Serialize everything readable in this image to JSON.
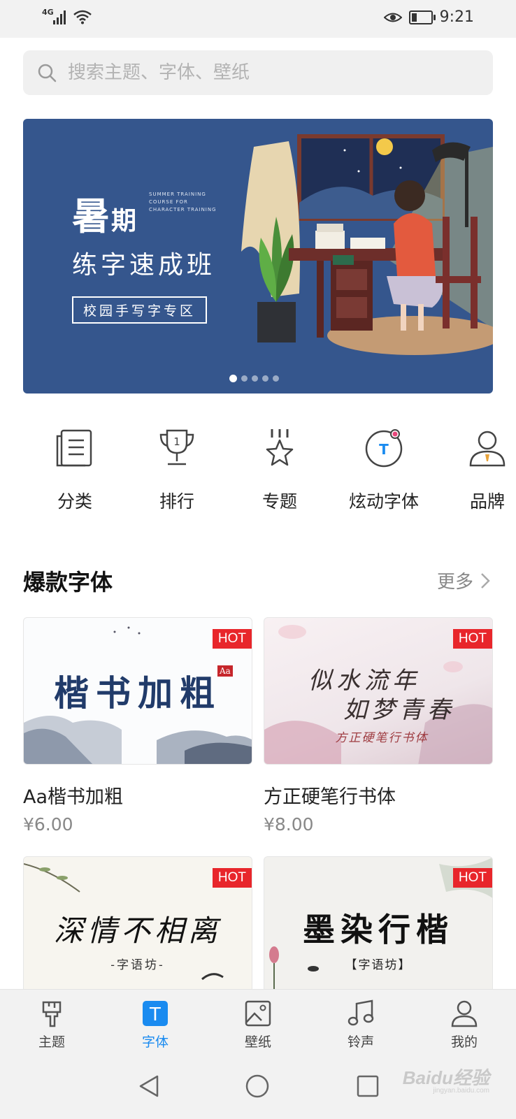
{
  "status_bar": {
    "network": "4G",
    "time": "9:21",
    "battery_level": 0.3,
    "icons": [
      "signal-icon",
      "wifi-icon",
      "eye-icon",
      "battery-icon"
    ]
  },
  "search": {
    "placeholder": "搜索主题、字体、壁纸",
    "icon": "search-icon"
  },
  "banner": {
    "headline_1": "暑",
    "headline_1b": "期",
    "english_tag": "SUMMER TRAINING COURSE FOR CHARACTER TRAINING",
    "headline_2": "练字速成班",
    "tag": "校园手写字专区",
    "slide_count": 5,
    "active_slide": 1
  },
  "quick_nav": [
    {
      "label": "分类",
      "icon": "category-icon"
    },
    {
      "label": "排行",
      "icon": "trophy-icon"
    },
    {
      "label": "专题",
      "icon": "topic-star-icon"
    },
    {
      "label": "炫动字体",
      "icon": "dynamic-font-icon"
    },
    {
      "label": "品牌",
      "icon": "brand-person-icon"
    }
  ],
  "section": {
    "title": "爆款字体",
    "more_label": "更多"
  },
  "cards": [
    {
      "art_text": "楷书加粗",
      "badge": "HOT",
      "seal": "Aa",
      "title": "Aa楷书加粗",
      "price": "¥6.00"
    },
    {
      "art_text_1": "似水流年",
      "art_text_2": "如梦青春",
      "art_sub": "方正硬笔行书体",
      "badge": "HOT",
      "title": "方正硬笔行书体",
      "price": "¥8.00"
    },
    {
      "art_text": "深情不相离",
      "art_sub": "-字语坊-",
      "badge": "HOT"
    },
    {
      "art_text": "墨染行楷",
      "art_sub": "【字语坊】",
      "badge": "HOT"
    }
  ],
  "bottom_nav": [
    {
      "label": "主题",
      "icon": "brush-icon",
      "active": false
    },
    {
      "label": "字体",
      "icon": "font-t-icon",
      "active": true
    },
    {
      "label": "壁纸",
      "icon": "picture-icon",
      "active": false
    },
    {
      "label": "铃声",
      "icon": "music-note-icon",
      "active": false
    },
    {
      "label": "我的",
      "icon": "person-icon",
      "active": false
    }
  ],
  "watermark": {
    "text": "Baidu经验",
    "sub": "jingyan.baidu.com"
  },
  "colors": {
    "accent": "#1a8bf0",
    "hot": "#e8262b",
    "banner_bg": "#35568d"
  }
}
